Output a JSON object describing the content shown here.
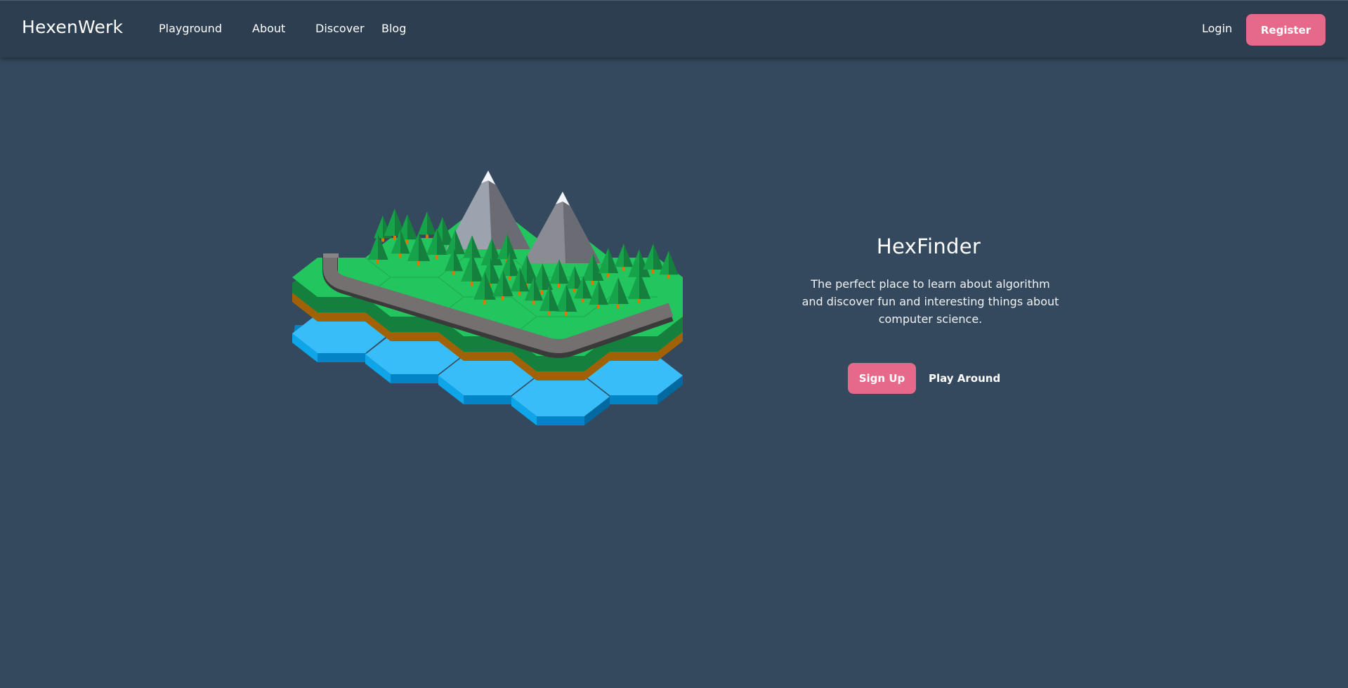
{
  "brand": {
    "name": "HexenWerk"
  },
  "nav": {
    "items": [
      {
        "label": "Playground"
      },
      {
        "label": "About"
      },
      {
        "label": "Discover"
      },
      {
        "label": "Blog"
      }
    ],
    "login_label": "Login",
    "register_label": "Register"
  },
  "hero": {
    "title": "HexFinder",
    "description": "The perfect place to learn about algorithm and discover fun and interesting things about computer science.",
    "signup_label": "Sign Up",
    "play_label": "Play Around",
    "illustration_icon": "hex-island-illustration"
  },
  "colors": {
    "background": "#34495e",
    "navbar": "#2c3e50",
    "accent": "#e6698a",
    "grass": "#22c55e",
    "water": "#38bdf8",
    "dirt": "#a16207",
    "rock": "#6b6b74"
  }
}
